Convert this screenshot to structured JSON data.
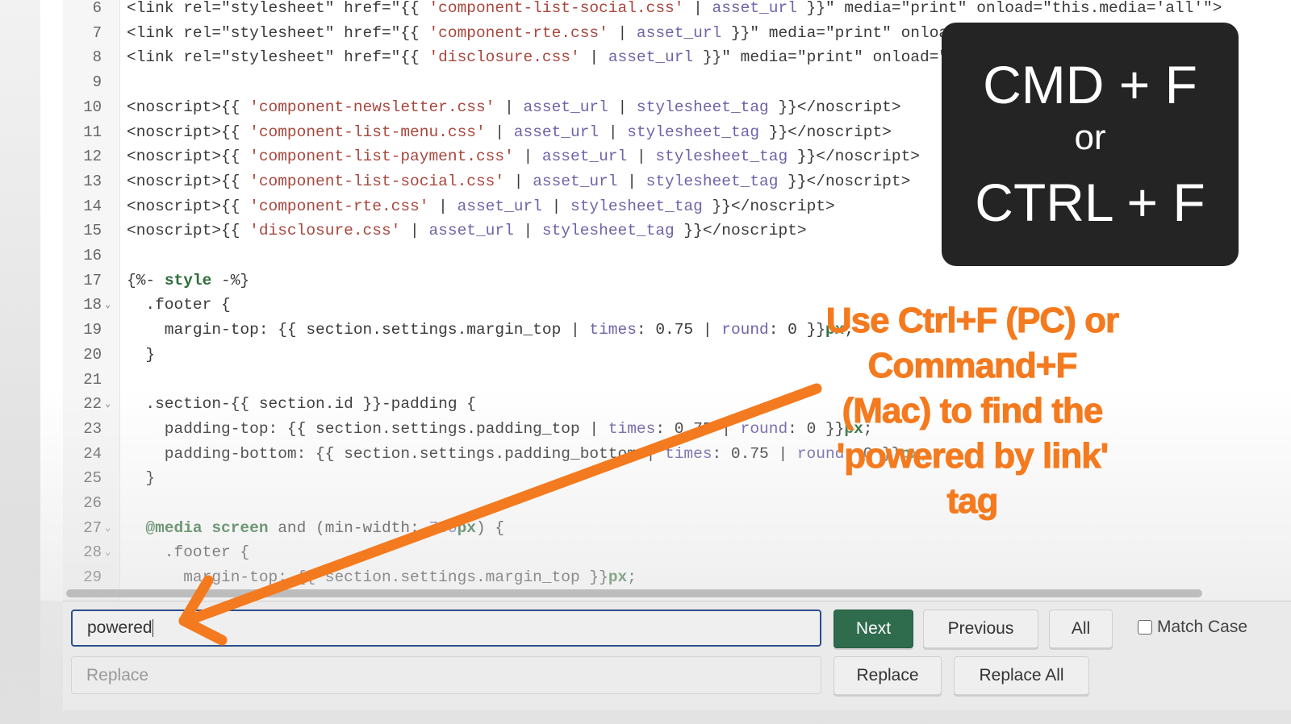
{
  "editor": {
    "lines": [
      {
        "n": "6",
        "fold": false,
        "tokens": [
          [
            "plain",
            "<link rel=\"stylesheet\" href=\"{{ "
          ],
          [
            "str",
            "'component-list-social.css'"
          ],
          [
            "plain",
            " | "
          ],
          [
            "filter",
            "asset_url"
          ],
          [
            "plain",
            " }}\" media=\"print\" onload=\"this.media='all'\">"
          ]
        ]
      },
      {
        "n": "7",
        "fold": false,
        "tokens": [
          [
            "plain",
            "<link rel=\"stylesheet\" href=\"{{ "
          ],
          [
            "str",
            "'component-rte.css'"
          ],
          [
            "plain",
            " | "
          ],
          [
            "filter",
            "asset_url"
          ],
          [
            "plain",
            " }}\" media=\"print\" onload=\"this.media='all'\">"
          ]
        ]
      },
      {
        "n": "8",
        "fold": false,
        "tokens": [
          [
            "plain",
            "<link rel=\"stylesheet\" href=\"{{ "
          ],
          [
            "str",
            "'disclosure.css'"
          ],
          [
            "plain",
            " | "
          ],
          [
            "filter",
            "asset_url"
          ],
          [
            "plain",
            " }}\" media=\"print\" onload=\"this.media='all'\">"
          ]
        ]
      },
      {
        "n": "9",
        "fold": false,
        "tokens": []
      },
      {
        "n": "10",
        "fold": false,
        "tokens": [
          [
            "plain",
            "<noscript>{{ "
          ],
          [
            "str",
            "'component-newsletter.css'"
          ],
          [
            "plain",
            " | "
          ],
          [
            "filter",
            "asset_url"
          ],
          [
            "plain",
            " | "
          ],
          [
            "filter",
            "stylesheet_tag"
          ],
          [
            "plain",
            " }}</noscript>"
          ]
        ]
      },
      {
        "n": "11",
        "fold": false,
        "tokens": [
          [
            "plain",
            "<noscript>{{ "
          ],
          [
            "str",
            "'component-list-menu.css'"
          ],
          [
            "plain",
            " | "
          ],
          [
            "filter",
            "asset_url"
          ],
          [
            "plain",
            " | "
          ],
          [
            "filter",
            "stylesheet_tag"
          ],
          [
            "plain",
            " }}</noscript>"
          ]
        ]
      },
      {
        "n": "12",
        "fold": false,
        "tokens": [
          [
            "plain",
            "<noscript>{{ "
          ],
          [
            "str",
            "'component-list-payment.css'"
          ],
          [
            "plain",
            " | "
          ],
          [
            "filter",
            "asset_url"
          ],
          [
            "plain",
            " | "
          ],
          [
            "filter",
            "stylesheet_tag"
          ],
          [
            "plain",
            " }}</noscript>"
          ]
        ]
      },
      {
        "n": "13",
        "fold": false,
        "tokens": [
          [
            "plain",
            "<noscript>{{ "
          ],
          [
            "str",
            "'component-list-social.css'"
          ],
          [
            "plain",
            " | "
          ],
          [
            "filter",
            "asset_url"
          ],
          [
            "plain",
            " | "
          ],
          [
            "filter",
            "stylesheet_tag"
          ],
          [
            "plain",
            " }}</noscript>"
          ]
        ]
      },
      {
        "n": "14",
        "fold": false,
        "tokens": [
          [
            "plain",
            "<noscript>{{ "
          ],
          [
            "str",
            "'component-rte.css'"
          ],
          [
            "plain",
            " | "
          ],
          [
            "filter",
            "asset_url"
          ],
          [
            "plain",
            " | "
          ],
          [
            "filter",
            "stylesheet_tag"
          ],
          [
            "plain",
            " }}</noscript>"
          ]
        ]
      },
      {
        "n": "15",
        "fold": false,
        "tokens": [
          [
            "plain",
            "<noscript>{{ "
          ],
          [
            "str",
            "'disclosure.css'"
          ],
          [
            "plain",
            " | "
          ],
          [
            "filter",
            "asset_url"
          ],
          [
            "plain",
            " | "
          ],
          [
            "filter",
            "stylesheet_tag"
          ],
          [
            "plain",
            " }}</noscript>"
          ]
        ]
      },
      {
        "n": "16",
        "fold": false,
        "tokens": []
      },
      {
        "n": "17",
        "fold": false,
        "tokens": [
          [
            "plain",
            "{%- "
          ],
          [
            "kw",
            "style"
          ],
          [
            "plain",
            " -%}"
          ]
        ]
      },
      {
        "n": "18",
        "fold": true,
        "tokens": [
          [
            "plain",
            "  .footer {"
          ]
        ]
      },
      {
        "n": "19",
        "fold": false,
        "tokens": [
          [
            "plain",
            "    margin-top: {{ section.settings.margin_top | "
          ],
          [
            "filter",
            "times"
          ],
          [
            "plain",
            ": 0.75 | "
          ],
          [
            "filter",
            "round"
          ],
          [
            "plain",
            ": 0 }}"
          ],
          [
            "kw",
            "px"
          ],
          [
            "plain",
            ";"
          ]
        ]
      },
      {
        "n": "20",
        "fold": false,
        "tokens": [
          [
            "plain",
            "  }"
          ]
        ]
      },
      {
        "n": "21",
        "fold": false,
        "tokens": []
      },
      {
        "n": "22",
        "fold": true,
        "tokens": [
          [
            "plain",
            "  .section-{{ section.id }}-padding {"
          ]
        ]
      },
      {
        "n": "23",
        "fold": false,
        "tokens": [
          [
            "plain",
            "    padding-top: {{ section.settings.padding_top | "
          ],
          [
            "filter",
            "times"
          ],
          [
            "plain",
            ": 0.75 | "
          ],
          [
            "filter",
            "round"
          ],
          [
            "plain",
            ": 0 }}"
          ],
          [
            "kw",
            "px"
          ],
          [
            "plain",
            ";"
          ]
        ]
      },
      {
        "n": "24",
        "fold": false,
        "tokens": [
          [
            "plain",
            "    padding-bottom: {{ section.settings.padding_bottom | "
          ],
          [
            "filter",
            "times"
          ],
          [
            "plain",
            ": 0.75 | "
          ],
          [
            "filter",
            "round"
          ],
          [
            "plain",
            ": 0 }}"
          ],
          [
            "kw",
            "px"
          ],
          [
            "plain",
            ";"
          ]
        ]
      },
      {
        "n": "25",
        "fold": false,
        "tokens": [
          [
            "plain",
            "  }"
          ]
        ]
      },
      {
        "n": "26",
        "fold": false,
        "tokens": []
      },
      {
        "n": "27",
        "fold": true,
        "tokens": [
          [
            "plain",
            "  "
          ],
          [
            "kw",
            "@media screen"
          ],
          [
            "plain",
            " and (min-width: "
          ],
          [
            "filter",
            "750"
          ],
          [
            "kw",
            "px"
          ],
          [
            "plain",
            ") {"
          ]
        ]
      },
      {
        "n": "28",
        "fold": true,
        "tokens": [
          [
            "plain",
            "    .footer {"
          ]
        ]
      },
      {
        "n": "29",
        "fold": false,
        "tokens": [
          [
            "plain",
            "      margin-top: {{ section.settings.margin_top }}"
          ],
          [
            "kw",
            "px"
          ],
          [
            "plain",
            ";"
          ]
        ]
      }
    ]
  },
  "findbar": {
    "find_value": "powered",
    "replace_placeholder": "Replace",
    "next_label": "Next",
    "previous_label": "Previous",
    "all_label": "All",
    "match_case_label": "Match Case",
    "match_case_checked": false,
    "replace_label": "Replace",
    "replace_all_label": "Replace All"
  },
  "overlay": {
    "shortcut_mac": "CMD + F",
    "shortcut_or": "or",
    "shortcut_pc": "CTRL + F",
    "callout_lines": [
      "Use Ctrl+F (PC) or",
      "Command+F",
      "(Mac) to find the",
      "'powered by link'",
      "tag"
    ]
  },
  "colors": {
    "accent_orange": "#f47a1f",
    "next_button": "#2f6b4d",
    "find_border": "#2c4f8a",
    "string": "#a8473d",
    "filter": "#6e63a8",
    "keyword": "#2f6e3b"
  }
}
